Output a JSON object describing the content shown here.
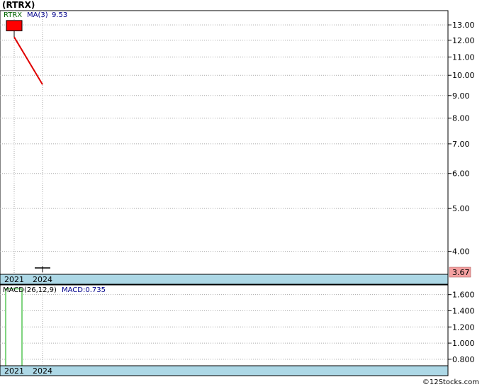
{
  "title": "(RTRX)",
  "legend": {
    "symbol": "RTRX",
    "ma_label": "MA(3)",
    "ma_value": "9.53"
  },
  "macd_legend": {
    "params": "MACD(26,12,9)",
    "value_text": "MACD:0.735"
  },
  "last_price_badge": "3.67",
  "watermark": "©12Stocks.com",
  "colors": {
    "candle_red": "#ff0000",
    "ma_line": "#e00000",
    "axis_band": "#add8e6",
    "badge_bg": "#f4a0a0",
    "symbol_green": "#006600",
    "ma_blue": "#00008b"
  },
  "chart_data": [
    {
      "type": "candlestick",
      "scale": "log",
      "x": [
        "2021",
        "2024"
      ],
      "xtick_labels": [
        "2021",
        "2024"
      ],
      "yticks": [
        4.0,
        5.0,
        6.0,
        7.0,
        8.0,
        9.0,
        10.0,
        11.0,
        12.0,
        13.0
      ],
      "ytick_labels": [
        "4.00",
        "5.00",
        "6.00",
        "7.00",
        "8.00",
        "9.00",
        "10.00",
        "11.00",
        "12.00",
        "13.00"
      ],
      "ylim": [
        3.55,
        14.0
      ],
      "candles": [
        {
          "x": "2021",
          "open": 12.6,
          "close": 13.3,
          "high": 13.3,
          "low": 12.2,
          "color": "red"
        },
        {
          "x": "2024",
          "open": 3.67,
          "close": 3.67,
          "high": 3.7,
          "low": 3.59,
          "color": "flat"
        }
      ],
      "ma_series": {
        "name": "MA(3)",
        "points": [
          {
            "x": "2021",
            "y": 12.2
          },
          {
            "x": "2024",
            "y": 9.53
          }
        ]
      }
    },
    {
      "type": "bar",
      "name": "MACD(26,12,9)",
      "x": [
        "2021",
        "2024"
      ],
      "xtick_labels": [
        "2021",
        "2024"
      ],
      "values": [
        1.67,
        0.0
      ],
      "yticks": [
        0.8,
        1.0,
        1.2,
        1.4,
        1.6
      ],
      "ytick_labels": [
        "0.800",
        "1.000",
        "1.200",
        "1.400",
        "1.600"
      ],
      "ylim": [
        0.72,
        1.72
      ]
    }
  ]
}
